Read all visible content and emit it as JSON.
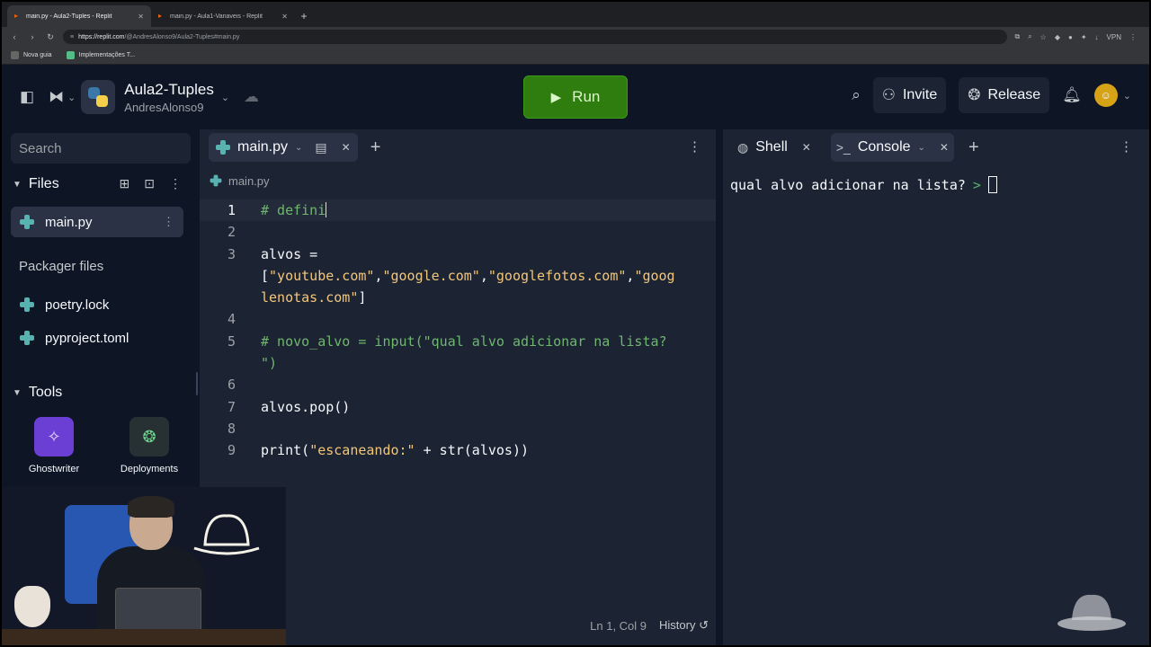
{
  "browser": {
    "tabs": [
      {
        "title": "main.py - Aula2-Tuples - Replit",
        "active": true
      },
      {
        "title": "main.py - Aula1-Variaveis - Replit",
        "active": false
      }
    ],
    "url_host": "https://replit.com",
    "url_path": "/@AndresAlonso9/Aula2-Tuples#main.py",
    "bookmarks": [
      "Nova guia",
      "Implementações T..."
    ]
  },
  "header": {
    "project_name": "Aula2-Tuples",
    "owner": "AndresAlonso9",
    "run_label": "Run",
    "invite_label": "Invite",
    "release_label": "Release"
  },
  "sidebar": {
    "search_placeholder": "Search",
    "files_label": "Files",
    "files": [
      {
        "name": "main.py",
        "selected": true
      }
    ],
    "packager_label": "Packager files",
    "packager_files": [
      "poetry.lock",
      "pyproject.toml"
    ],
    "tools_label": "Tools",
    "tools": [
      "Ghostwriter",
      "Deployments"
    ]
  },
  "editor": {
    "tab_label": "main.py",
    "breadcrumb": "main.py",
    "lines": [
      {
        "n": "1",
        "parts": [
          {
            "t": "# defini",
            "c": "com"
          }
        ]
      },
      {
        "n": "2",
        "parts": []
      },
      {
        "n": "3",
        "parts": [
          {
            "t": "alvos = ",
            "c": "plain"
          }
        ]
      },
      {
        "n": "",
        "parts": [
          {
            "t": "[",
            "c": "plain"
          },
          {
            "t": "\"youtube.com\"",
            "c": "str"
          },
          {
            "t": ",",
            "c": "plain"
          },
          {
            "t": "\"google.com\"",
            "c": "str"
          },
          {
            "t": ",",
            "c": "plain"
          },
          {
            "t": "\"googlefotos.com\"",
            "c": "str"
          },
          {
            "t": ",",
            "c": "plain"
          },
          {
            "t": "\"goog",
            "c": "str"
          }
        ]
      },
      {
        "n": "",
        "parts": [
          {
            "t": "lenotas.com\"",
            "c": "str"
          },
          {
            "t": "]",
            "c": "plain"
          }
        ]
      },
      {
        "n": "4",
        "parts": []
      },
      {
        "n": "5",
        "parts": [
          {
            "t": "# novo_alvo = input(\"qual alvo adicionar na lista?",
            "c": "com"
          }
        ]
      },
      {
        "n": "",
        "parts": [
          {
            "t": "\")",
            "c": "com"
          }
        ]
      },
      {
        "n": "6",
        "parts": []
      },
      {
        "n": "7",
        "parts": [
          {
            "t": "alvos.pop()",
            "c": "plain"
          }
        ]
      },
      {
        "n": "8",
        "parts": []
      },
      {
        "n": "9",
        "parts": [
          {
            "t": "print(",
            "c": "plain"
          },
          {
            "t": "\"escaneando:\"",
            "c": "str"
          },
          {
            "t": " + str(alvos))",
            "c": "plain"
          }
        ]
      }
    ],
    "cursor_pos": "Ln 1, Col 9",
    "history_label": "History"
  },
  "console": {
    "shell_label": "Shell",
    "console_label": "Console",
    "output": "qual alvo adicionar na lista?",
    "prompt": ">"
  }
}
